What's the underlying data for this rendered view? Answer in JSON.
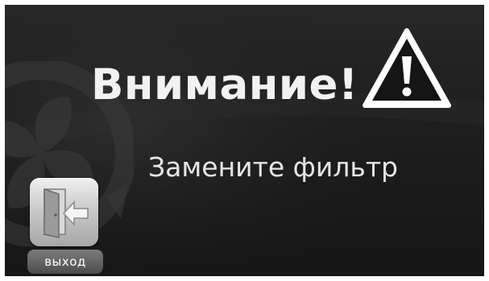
{
  "alert": {
    "title": "Внимание!",
    "message": "Замените фильтр"
  },
  "exit_button": {
    "label": "выход",
    "icon": "exit-door-icon"
  },
  "icons": {
    "warning": "warning-triangle-icon",
    "background": "fan-watermark-icon"
  },
  "colors": {
    "background": "#1e1e1e",
    "text": "#f2f2f2",
    "button_tile": "#c9c9c9",
    "button_label_bg": "#5e5e5e"
  }
}
